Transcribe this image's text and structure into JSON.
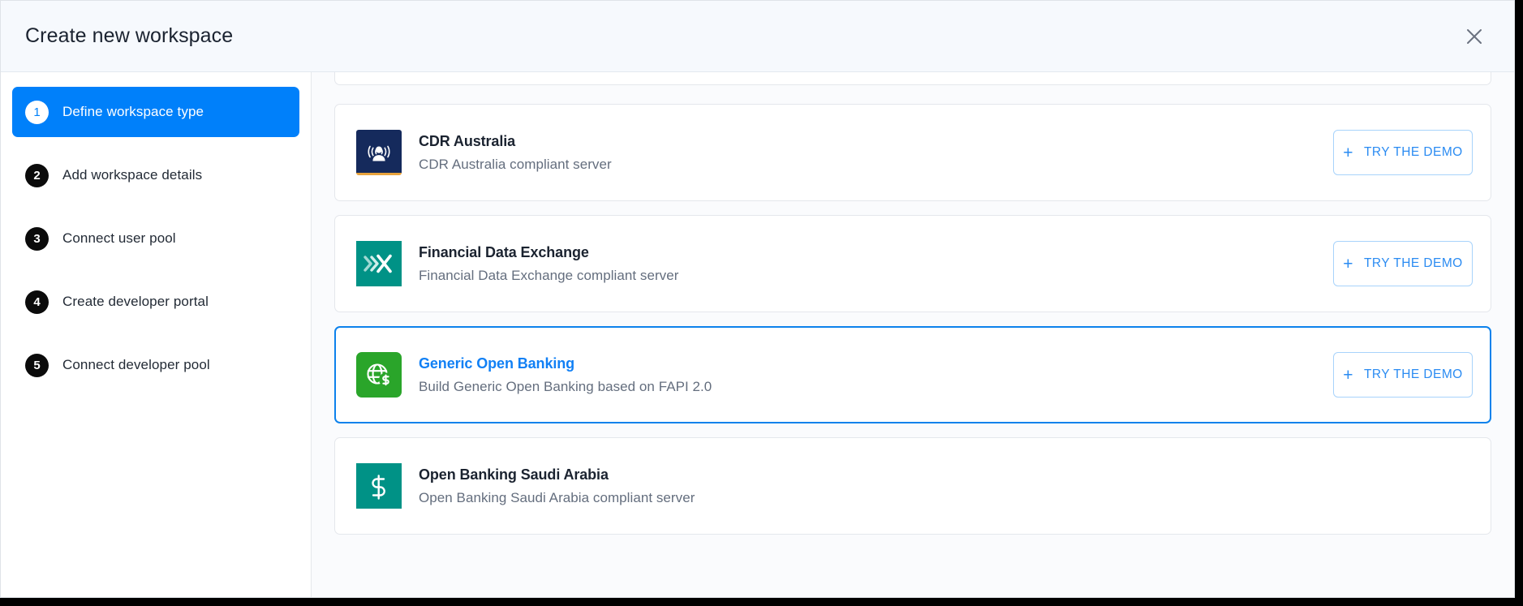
{
  "dialog": {
    "title": "Create new workspace",
    "close_icon": "close-icon"
  },
  "sidebar": {
    "steps": [
      {
        "number": "1",
        "label": "Define workspace type",
        "active": true
      },
      {
        "number": "2",
        "label": "Add workspace details",
        "active": false
      },
      {
        "number": "3",
        "label": "Connect user pool",
        "active": false
      },
      {
        "number": "4",
        "label": "Create developer portal",
        "active": false
      },
      {
        "number": "5",
        "label": "Connect developer pool",
        "active": false
      }
    ]
  },
  "content": {
    "demo_button_label": "TRY THE DEMO",
    "demo_button_plus": "+",
    "cards": [
      {
        "title": "CDR Australia",
        "description": "CDR Australia compliant server",
        "icon": "fingerprint-person-icon",
        "icon_bg": "#152a5c",
        "icon_accent": "#e8a33d",
        "selected": false
      },
      {
        "title": "Financial Data Exchange",
        "description": "Financial Data Exchange compliant server",
        "icon": "chevron-x-icon",
        "icon_bg": "#009286",
        "selected": false
      },
      {
        "title": "Generic Open Banking",
        "description": "Build Generic Open Banking based on FAPI 2.0",
        "icon": "globe-dollar-icon",
        "icon_bg": "#2aa52a",
        "selected": true
      },
      {
        "title": "Open Banking Saudi Arabia",
        "description": "Open Banking Saudi Arabia compliant server",
        "icon": "dollar-sign-icon",
        "icon_bg": "#009286",
        "selected": false
      }
    ]
  },
  "colors": {
    "accent_blue": "#0080fa",
    "selected_border": "#0d82ec",
    "header_bg": "#f6f9fd",
    "content_bg": "#fafbfd"
  }
}
